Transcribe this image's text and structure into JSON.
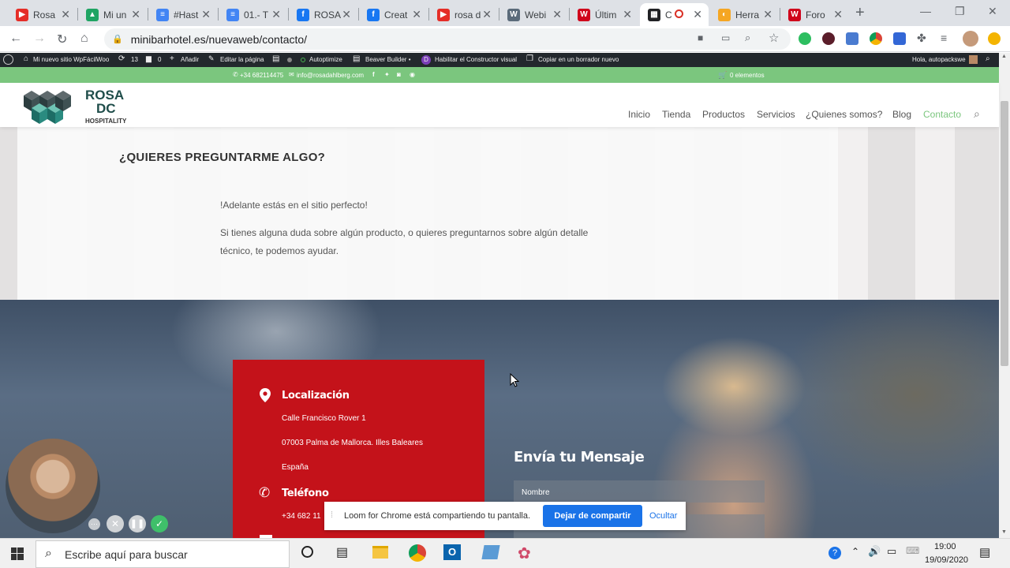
{
  "browser": {
    "tabs": [
      {
        "label": "Rosa",
        "fav_color": "#e52d27",
        "fav_glyph": "▶"
      },
      {
        "label": "Mi un",
        "fav_color": "#1fa463",
        "fav_glyph": "▲"
      },
      {
        "label": "#Hast",
        "fav_color": "#4285f4",
        "fav_glyph": "≡"
      },
      {
        "label": "01.- T",
        "fav_color": "#4285f4",
        "fav_glyph": "≡"
      },
      {
        "label": "ROSA",
        "fav_color": "#1877f2",
        "fav_glyph": "f"
      },
      {
        "label": "Creat",
        "fav_color": "#1877f2",
        "fav_glyph": "f"
      },
      {
        "label": "rosa d",
        "fav_color": "#e52d27",
        "fav_glyph": "▶"
      },
      {
        "label": "Webi",
        "fav_color": "#5b6b7a",
        "fav_glyph": "W"
      },
      {
        "label": "Últim",
        "fav_color": "#d0021b",
        "fav_glyph": "W"
      },
      {
        "label": "C",
        "fav_color": "#202124",
        "fav_glyph": "▦"
      },
      {
        "label": "Herra",
        "fav_color": "#f5a623",
        "fav_glyph": "◐"
      },
      {
        "label": "Foro",
        "fav_color": "#d0021b",
        "fav_glyph": "W"
      }
    ],
    "url": "minibarhotel.es/nuevaweb/contacto/"
  },
  "wp_admin": {
    "site_name": "Mi nuevo sitio WpFácilWoo",
    "updates": "13",
    "comments": "0",
    "add_new": "Añadir",
    "edit_page": "Editar la página",
    "autoptimize": "Autoptimize",
    "beaver": "Beaver Builder •",
    "visual_builder": "Habilitar el Constructor visual",
    "copy_draft": "Copiar en un borrador nuevo",
    "greeting": "Hola, autopackswe"
  },
  "topbar": {
    "phone": "+34 682114475",
    "email": "info@rosadahlberg.com",
    "cart": "0 elementos"
  },
  "site": {
    "logo_line1": "ROSA",
    "logo_line2": "DC",
    "logo_line3": "HOSPITALITY",
    "nav": [
      "Inicio",
      "Tienda",
      "Productos",
      "Servicios",
      "¿Quienes somos?",
      "Blog",
      "Contacto"
    ],
    "accent_color": "#7bc67e"
  },
  "intro": {
    "heading": "¿QUIERES PREGUNTARME ALGO?",
    "lead": "!Adelante estás en el sitio perfecto!",
    "body_line1": "Si tienes alguna duda sobre algún producto, o quieres preguntarnos sobre algún detalle",
    "body_line2": "técnico, te podemos ayudar."
  },
  "contact": {
    "location_title": "Localización",
    "address1": "Calle Francisco Rover 1",
    "address2": "07003 Palma de Mallorca. Illes Baleares",
    "country": "España",
    "phone_title": "Teléfono",
    "phone_value": "+34 682 11",
    "form_title": "Envía tu Mensaje",
    "name_label": "Nombre"
  },
  "loom": {
    "message": "Loom for Chrome está compartiendo tu pantalla.",
    "stop_button": "Dejar de compartir",
    "hide_button": "Ocultar"
  },
  "taskbar": {
    "search_placeholder": "Escribe aquí para buscar",
    "time": "19:00",
    "date": "19/09/2020"
  }
}
